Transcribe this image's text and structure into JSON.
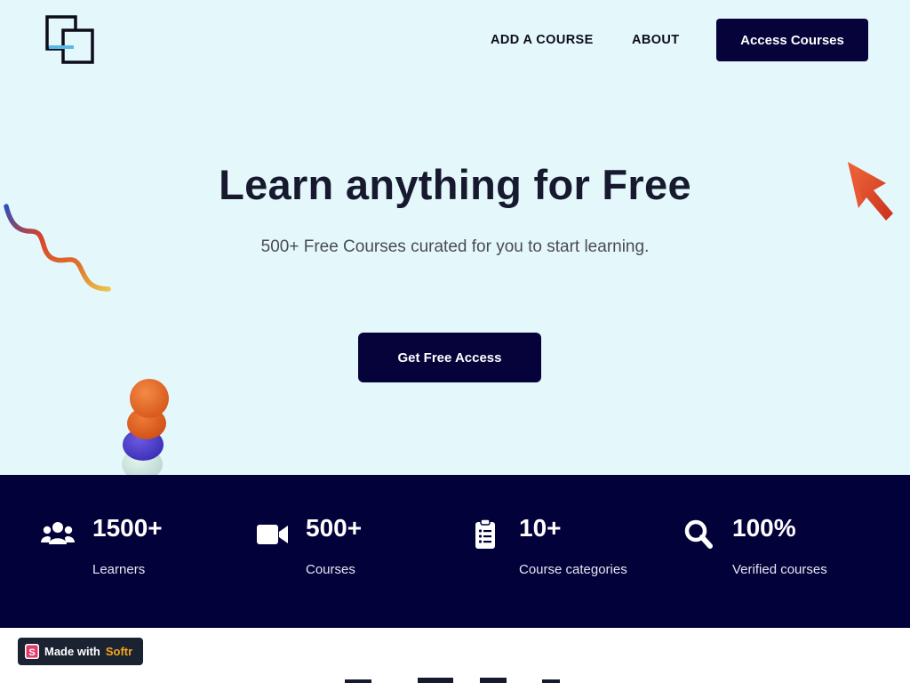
{
  "header": {
    "nav": [
      {
        "label": "ADD A COURSE"
      },
      {
        "label": "ABOUT"
      }
    ],
    "cta_label": "Access Courses"
  },
  "hero": {
    "title": "Learn anything for Free",
    "subtitle": "500+ Free Courses curated for you to start learning.",
    "cta_label": "Get Free Access"
  },
  "stats": [
    {
      "icon": "users-icon",
      "value": "1500+",
      "label": "Learners"
    },
    {
      "icon": "video-camera-icon",
      "value": "500+",
      "label": "Courses"
    },
    {
      "icon": "clipboard-list-icon",
      "value": "10+",
      "label": "Course categories"
    },
    {
      "icon": "search-icon",
      "value": "100%",
      "label": "Verified courses"
    }
  ],
  "badge": {
    "prefix": "Made with",
    "brand": "Softr"
  },
  "colors": {
    "hero_bg": "#e4f8fc",
    "primary": "#05033a",
    "stats_bg": "#03013a",
    "badge_bg": "#1b2333",
    "brand_accent": "#f7a51c"
  }
}
